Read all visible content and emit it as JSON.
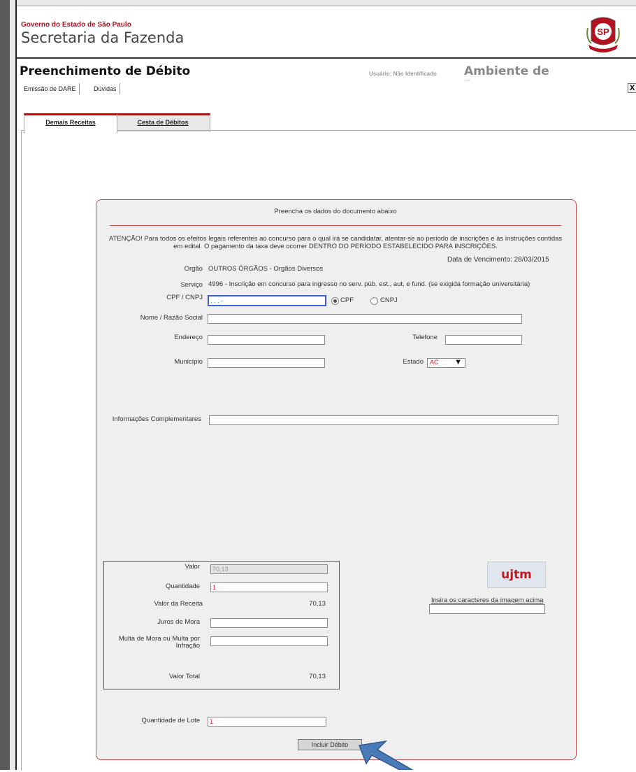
{
  "header": {
    "gov_label": "Governo do Estado de São Paulo",
    "secretaria": "Secretaria da Fazenda",
    "seal_text": "SP",
    "page_title": "Preenchimento de Débito",
    "user_label": "Usuário: Não Identificado",
    "env_title": "Ambiente de Pagamentos",
    "exit_label": "X"
  },
  "menu": [
    "Emissão de DARE",
    "Dúvidas"
  ],
  "tabs": [
    "Demais Receitas",
    "Cesta de Débitos"
  ],
  "form": {
    "instruction": "Preencha os dados do documento abaixo",
    "attention": "ATENÇÃO! Para todos os efeitos legais referentes ao concurso para o qual irá se candidatar, atentar-se ao período de inscrições e às instruções contidas em edital. O pagamento da taxa deve ocorrer DENTRO DO PERÍODO ESTABELECIDO PARA INSCRIÇÕES.",
    "due_date": "Data de Vencimento: 28/03/2015",
    "orgao_label": "Orgão",
    "orgao_value": "OUTROS ÓRGÃOS - Orgãos Diversos",
    "servico_label": "Serviço",
    "servico_value": "4996 - Inscrição em concurso para ingresso no serv. púb. est., aut. e fund. (se exigida formação universitária)",
    "cpf_label": "CPF / CNPJ",
    "cpf_value": ". . . -",
    "radio_cpf": "CPF",
    "radio_cnpj": "CNPJ",
    "nome_label": "Nome / Razão Social",
    "endereco_label": "Endereço",
    "telefone_label": "Telefone",
    "municipio_label": "Município",
    "estado_label": "Estado",
    "estado_value": "AC",
    "info_label": "Informações Complementares",
    "valor_label": "Valor",
    "valor_value": "70,13",
    "quantidade_label": "Quantidade",
    "quantidade_value": "1",
    "valor_receita_label": "Valor da Receita",
    "valor_receita_value": "70,13",
    "juros_label": "Juros de Mora",
    "multa_label": "Multa de Mora ou Multa por Infração",
    "valor_total_label": "Valor Total",
    "valor_total_value": "70,13",
    "captcha_text": "ujtm",
    "captcha_label": "Insira os caracteres da imagem acima",
    "lote_label": "Quantidade de Lote",
    "lote_value": "1",
    "submit_label": "Incluir Débito"
  },
  "colors": {
    "accent": "#c24a4a",
    "focus": "#3b5fcf",
    "arrow": "#4a7ab8"
  }
}
